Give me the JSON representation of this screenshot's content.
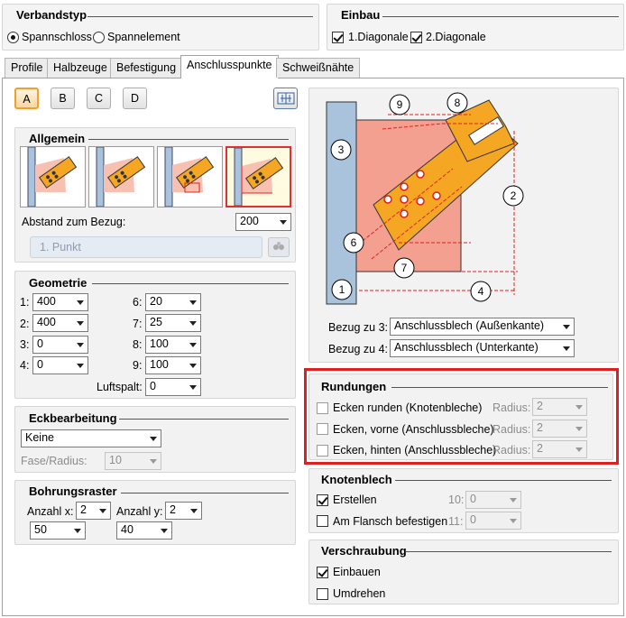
{
  "verbandstyp": {
    "title": "Verbandstyp",
    "opt1": "Spannschloss",
    "opt2": "Spannelement"
  },
  "einbau": {
    "title": "Einbau",
    "opt1": "1.Diagonale",
    "opt2": "2.Diagonale"
  },
  "tabs": [
    "Profile",
    "Halbzeuge",
    "Befestigung",
    "Anschlusspunkte",
    "Schweißnähte"
  ],
  "subtabs": [
    "A",
    "B",
    "C",
    "D"
  ],
  "allgemein": {
    "title": "Allgemein",
    "abstand_label": "Abstand zum Bezug:",
    "abstand_value": "200",
    "punkt_placeholder": "1. Punkt"
  },
  "geometrie": {
    "title": "Geometrie",
    "labels": [
      "1:",
      "2:",
      "3:",
      "4:",
      "6:",
      "7:",
      "8:",
      "9:"
    ],
    "values": [
      "400",
      "400",
      "0",
      "0",
      "20",
      "25",
      "100",
      "100"
    ],
    "luftspalt_label": "Luftspalt:",
    "luftspalt_value": "0"
  },
  "eckbearbeitung": {
    "title": "Eckbearbeitung",
    "value": "Keine",
    "fase_label": "Fase/Radius:",
    "fase_value": "10"
  },
  "bohrungsraster": {
    "title": "Bohrungsraster",
    "ax_label": "Anzahl x:",
    "ax_value": "2",
    "ay_label": "Anzahl y:",
    "ay_value": "2",
    "x_value": "50",
    "y_value": "40"
  },
  "diagram": {
    "callouts": [
      "1",
      "2",
      "3",
      "4",
      "6",
      "7",
      "8",
      "9"
    ]
  },
  "bezug": {
    "label3": "Bezug zu 3:",
    "value3": "Anschlussblech (Außenkante)",
    "label4": "Bezug zu 4:",
    "value4": "Anschlussblech (Unterkante)"
  },
  "rundungen": {
    "title": "Rundungen",
    "rows": [
      {
        "label": "Ecken runden (Knotenbleche)",
        "radius_label": "Radius:",
        "radius_value": "2"
      },
      {
        "label": "Ecken, vorne (Anschlussbleche)",
        "radius_label": "Radius:",
        "radius_value": "2"
      },
      {
        "label": "Ecken, hinten (Anschlussbleche)",
        "radius_label": "Radius:",
        "radius_value": "2"
      }
    ],
    "highlight_color": "#e02020"
  },
  "knotenblech": {
    "title": "Knotenblech",
    "erstellen": "Erstellen",
    "flansch": "Am Flansch befestigen",
    "l10": "10:",
    "v10": "0",
    "l11": "11:",
    "v11": "0"
  },
  "verschraubung": {
    "title": "Verschraubung",
    "einbauen": "Einbauen",
    "umdrehen": "Umdrehen"
  },
  "colors": {
    "plate": "#f4a090",
    "bracket": "#f5a623",
    "column": "#a9c3dc",
    "dim": "#e02020"
  }
}
